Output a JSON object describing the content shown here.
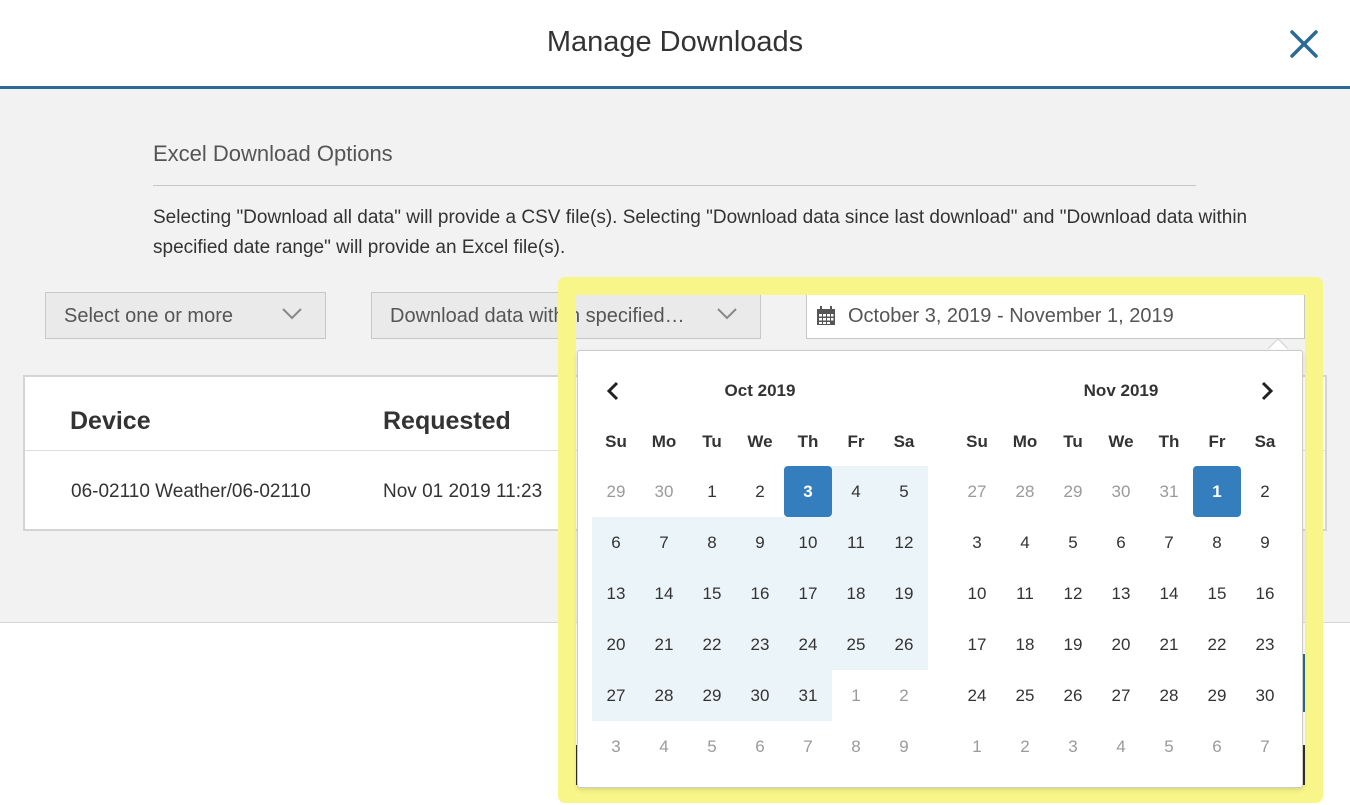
{
  "header": {
    "title": "Manage Downloads",
    "close_icon": "close-icon"
  },
  "options": {
    "section_title": "Excel Download Options",
    "description": "Selecting \"Download all data\" will provide a CSV file(s). Selecting \"Download data since last download\" and \"Download data within specified date range\" will provide an Excel file(s).",
    "device_select": "Select one or more",
    "mode_select": "Download data within specified…",
    "date_range": "October 3, 2019 - November 1, 2019"
  },
  "table": {
    "headers": [
      "Device",
      "Requested"
    ],
    "rows": [
      {
        "device": "06-02110 Weather/06-02110",
        "requested": "Nov 01 2019 11:23"
      }
    ]
  },
  "calendar": {
    "left_title": "Oct 2019",
    "right_title": "Nov 2019",
    "weekdays": [
      "Su",
      "Mo",
      "Tu",
      "We",
      "Th",
      "Fr",
      "Sa"
    ],
    "left_weeks": [
      [
        "29",
        "30",
        "1",
        "2",
        "3",
        "4",
        "5"
      ],
      [
        "6",
        "7",
        "8",
        "9",
        "10",
        "11",
        "12"
      ],
      [
        "13",
        "14",
        "15",
        "16",
        "17",
        "18",
        "19"
      ],
      [
        "20",
        "21",
        "22",
        "23",
        "24",
        "25",
        "26"
      ],
      [
        "27",
        "28",
        "29",
        "30",
        "31",
        "1",
        "2"
      ],
      [
        "3",
        "4",
        "5",
        "6",
        "7",
        "8",
        "9"
      ]
    ],
    "right_weeks": [
      [
        "27",
        "28",
        "29",
        "30",
        "31",
        "1",
        "2"
      ],
      [
        "3",
        "4",
        "5",
        "6",
        "7",
        "8",
        "9"
      ],
      [
        "10",
        "11",
        "12",
        "13",
        "14",
        "15",
        "16"
      ],
      [
        "17",
        "18",
        "19",
        "20",
        "21",
        "22",
        "23"
      ],
      [
        "24",
        "25",
        "26",
        "27",
        "28",
        "29",
        "30"
      ],
      [
        "1",
        "2",
        "3",
        "4",
        "5",
        "6",
        "7"
      ]
    ],
    "range_start": "Oct 3 2019",
    "range_end": "Nov 1 2019",
    "colors": {
      "selected": "#357ebd",
      "in_range": "#ebf4f8",
      "highlight": "#f8f688",
      "header_rule": "#2b6a94"
    }
  }
}
